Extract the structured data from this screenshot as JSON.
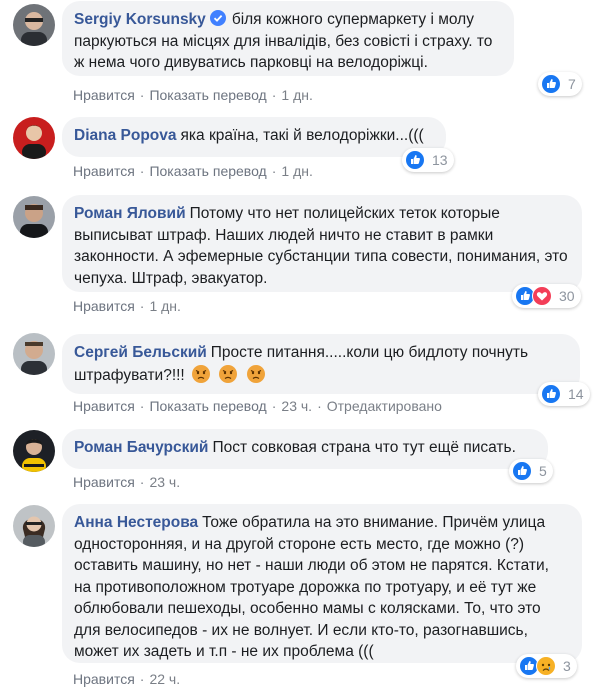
{
  "comments": [
    {
      "author": "Sergiy Korsunsky",
      "verified": true,
      "text": "біля кожного супермаркету і молу паркуються на місцях для інвалідів, без совісті і страху. то ж нема чого дивуватись парковці на велодоріжці.",
      "actions": {
        "like": "Нравится",
        "translate": "Показать перевод",
        "time": "1 дн."
      },
      "reactions": {
        "icons": [
          "like-icon"
        ],
        "count": "7"
      }
    },
    {
      "author": "Diana Popova",
      "text": "яка країна, такі й велодоріжки...(((",
      "actions": {
        "like": "Нравится",
        "translate": "Показать перевод",
        "time": "1 дн."
      },
      "reactions": {
        "icons": [
          "like-icon"
        ],
        "count": "13"
      }
    },
    {
      "author": "Роман Яловий",
      "text": "Потому что нет полицейских теток которые выписыват штраф. Наших людей ничто не ставит в рамки законности. А эфемерные субстанции типа совести, понимания, это чепуха. Штраф, эвакуатор.",
      "actions": {
        "like": "Нравится",
        "time": "1 дн."
      },
      "reactions": {
        "icons": [
          "like-icon",
          "love-icon"
        ],
        "count": "30"
      }
    },
    {
      "author": "Сергей Бельский",
      "text": "Просте питання.....коли цю бидлоту почнуть штрафувати?!!!",
      "emoji": [
        "angry-face-icon",
        "angry-face-icon",
        "angry-face-icon"
      ],
      "actions": {
        "like": "Нравится",
        "translate": "Показать перевод",
        "time": "23 ч.",
        "edited": "Отредактировано"
      },
      "reactions": {
        "icons": [
          "like-icon"
        ],
        "count": "14"
      }
    },
    {
      "author": "Роман Бачурский",
      "text": "Пост совковая страна что тут ещё писать.",
      "actions": {
        "like": "Нравится",
        "time": "23 ч."
      },
      "reactions": {
        "icons": [
          "like-icon"
        ],
        "count": "5"
      }
    },
    {
      "author": "Анна Нестерова",
      "text": "Тоже обратила на это внимание. Причём улица односторонняя, и на другой стороне есть место, где можно (?) оставить машину, но нет - наши люди об этом не парятся. Кстати, на противоположном тротуаре дорожка по тротуару, и её тут же облюбовали пешеходы, особенно мамы с колясками. То, что это для велосипедов - их не волнует. И если кто-то, разогнавшись, может их задеть и т.п - не их проблема (((",
      "actions": {
        "like": "Нравится",
        "time": "22 ч."
      },
      "reactions": {
        "icons": [
          "like-icon",
          "sad-icon"
        ],
        "count": "3"
      }
    }
  ],
  "colors": {
    "link": "#385898",
    "bubble": "#f2f3f5",
    "like": "#1877f2",
    "love": "#f33e58"
  }
}
